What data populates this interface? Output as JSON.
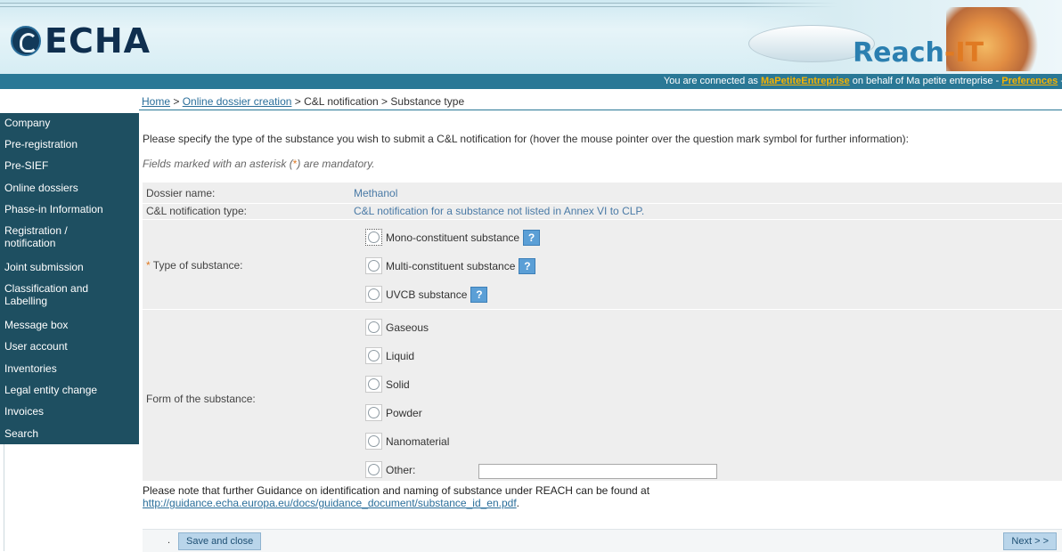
{
  "header": {
    "logo_text": "ECHA",
    "app_name": "Reach",
    "app_suffix": "IT",
    "status_prefix": "You are connected as ",
    "user_link": "MaPetiteEntreprise",
    "status_middle": " on behalf of Ma petite entreprise - ",
    "preferences_link": "Preferences",
    "status_suffix": " -"
  },
  "breadcrumb": {
    "home": "Home",
    "sep1": " > ",
    "online_dossier": "Online dossier creation",
    "rest": " > C&L notification > Substance type"
  },
  "sidebar": {
    "items": [
      {
        "label": "Company"
      },
      {
        "label": "Pre-registration"
      },
      {
        "label": "Pre-SIEF"
      },
      {
        "label": "Online dossiers"
      },
      {
        "label": "Phase-in Information"
      },
      {
        "label": "Registration / notification"
      },
      {
        "label": "Joint submission"
      },
      {
        "label": "Classification and Labelling"
      },
      {
        "label": "Message box"
      },
      {
        "label": "User account"
      },
      {
        "label": "Inventories"
      },
      {
        "label": "Legal entity change"
      },
      {
        "label": "Invoices"
      },
      {
        "label": "Search"
      }
    ]
  },
  "main": {
    "intro": "Please specify the type of the substance you wish to submit a C&L notification for (hover the mouse pointer over the question mark symbol for further information):",
    "note_prefix": "Fields marked with an asterisk (",
    "note_ast": "*",
    "note_suffix": ") are mandatory.",
    "dossier_name_label": "Dossier name:",
    "dossier_name_value": "Methanol",
    "notification_type_label": "C&L notification type:",
    "notification_type_value": "C&L notification for a substance not listed in Annex VI to CLP.",
    "type_label_ast": "*",
    "type_label": " Type of substance:",
    "type_options": [
      {
        "label": "Mono-constituent substance",
        "help": "?"
      },
      {
        "label": "Multi-constituent substance",
        "help": "?"
      },
      {
        "label": "UVCB substance",
        "help": "?"
      }
    ],
    "form_label": "Form of the substance:",
    "form_options": [
      {
        "label": "Gaseous"
      },
      {
        "label": "Liquid"
      },
      {
        "label": "Solid"
      },
      {
        "label": "Powder"
      },
      {
        "label": "Nanomaterial"
      },
      {
        "label": "Other:"
      }
    ],
    "other_value": "",
    "guidance_line1": "Please note that further Guidance on identification and naming of substance under REACH can be found at",
    "guidance_link": "http://guidance.echa.europa.eu/docs/guidance_document/substance_id_en.pdf",
    "guidance_end": "."
  },
  "footer": {
    "dot": ".",
    "save_close": "Save and close",
    "next": "Next > >"
  },
  "colors": {
    "sidebar_bg": "#1e4f61",
    "status_bar_bg": "#2a7896",
    "link_color": "#2a6e9a",
    "highlight_link": "#f6b300",
    "accent_orange": "#e07a22"
  }
}
